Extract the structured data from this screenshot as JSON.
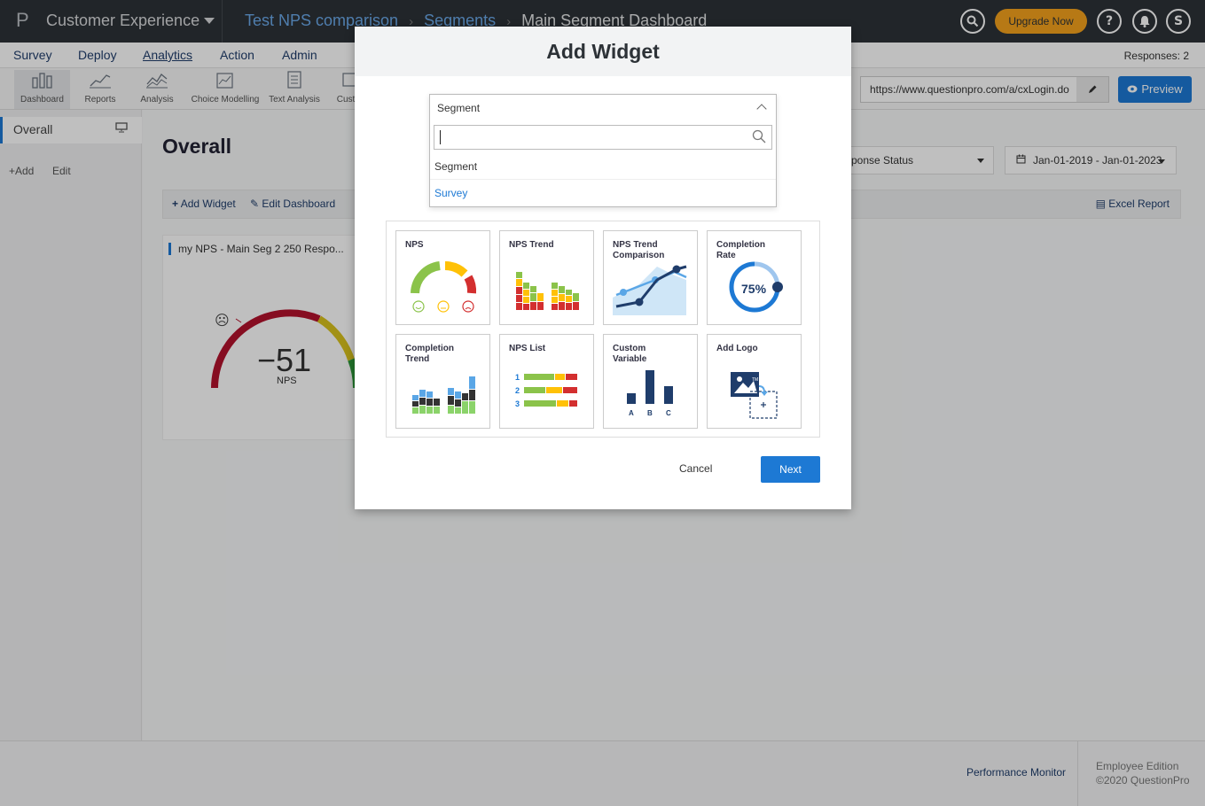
{
  "topbar": {
    "logo": "P",
    "product": "Customer Experience",
    "breadcrumbs": [
      "Test NPS comparison",
      "Segments",
      "Main Segment Dashboard"
    ],
    "breadcrumb_sep": "›",
    "upgrade": "Upgrade Now",
    "help": "?",
    "user_initial": "S"
  },
  "nav": {
    "items": [
      "Survey",
      "Deploy",
      "Analytics",
      "Action",
      "Admin"
    ],
    "active": "Analytics",
    "responses": "Responses: 2"
  },
  "toolbar": {
    "tools": [
      {
        "label": "Dashboard",
        "icon": "bar-chart-icon"
      },
      {
        "label": "Reports",
        "icon": "line-chart-icon"
      },
      {
        "label": "Analysis",
        "icon": "area-chart-icon"
      },
      {
        "label": "Choice Modelling",
        "icon": "choice-icon"
      },
      {
        "label": "Text Analysis",
        "icon": "text-icon"
      },
      {
        "label": "Cust",
        "icon": "custom-icon"
      }
    ],
    "url": "https://www.questionpro.com/a/cxLogin.do",
    "preview": "Preview"
  },
  "sidebar": {
    "overall": "Overall",
    "add": "+Add",
    "edit": "Edit"
  },
  "main": {
    "title": "Overall",
    "filter": "ponse Status",
    "date_range": "Jan-01-2019 - Jan-01-2023",
    "add_widget": "Add Widget",
    "edit_dashboard": "Edit Dashboard",
    "excel": "Excel Report",
    "widget_title": "my NPS - Main Seg 2  250 Respo...",
    "nps_value": "−51",
    "nps_label": "NPS"
  },
  "modal": {
    "title": "Add Widget",
    "select_value": "Segment",
    "search_value": "",
    "options": [
      "Segment",
      "Survey"
    ],
    "tiles": [
      {
        "label": "NPS",
        "icon": "nps-gauge-icon"
      },
      {
        "label": "NPS Trend",
        "icon": "nps-trend-icon"
      },
      {
        "label": "NPS Trend Comparison",
        "icon": "trend-comparison-icon"
      },
      {
        "label": "Completion Rate",
        "icon": "completion-rate-icon",
        "value": "75%"
      },
      {
        "label": "Completion Trend",
        "icon": "completion-trend-icon"
      },
      {
        "label": "NPS List",
        "icon": "nps-list-icon",
        "numbers": [
          "1",
          "2",
          "3"
        ]
      },
      {
        "label": "Custom Variable",
        "icon": "custom-variable-icon",
        "letters": [
          "A",
          "B",
          "C"
        ]
      },
      {
        "label": "Add Logo",
        "icon": "add-logo-icon",
        "tm": "TM"
      }
    ],
    "cancel": "Cancel",
    "next": "Next"
  },
  "footer": {
    "performance": "Performance Monitor",
    "edition": "Employee Edition",
    "copyright": "©2020 QuestionPro"
  },
  "colors": {
    "accent": "#1d79d4",
    "upgrade": "#f4a21c",
    "topbar": "#2d3237",
    "promoter": "#8bc34a",
    "passive": "#ffc107",
    "detractor": "#d32f2f"
  }
}
